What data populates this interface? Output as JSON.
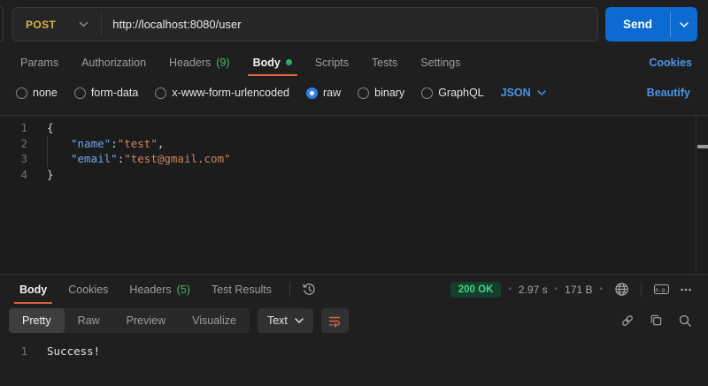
{
  "request_bar": {
    "method": "POST",
    "url": "http://localhost:8080/user",
    "send_label": "Send"
  },
  "request_tabs": {
    "items": [
      {
        "label": "Params"
      },
      {
        "label": "Authorization"
      },
      {
        "label": "Headers",
        "count": "(9)"
      },
      {
        "label": "Body",
        "active": true
      },
      {
        "label": "Scripts"
      },
      {
        "label": "Tests"
      },
      {
        "label": "Settings"
      }
    ],
    "cookies_link": "Cookies"
  },
  "body_type_bar": {
    "options": [
      {
        "label": "none"
      },
      {
        "label": "form-data"
      },
      {
        "label": "x-www-form-urlencoded"
      },
      {
        "label": "raw",
        "selected": true
      },
      {
        "label": "binary"
      },
      {
        "label": "GraphQL"
      }
    ],
    "format": "JSON",
    "beautify_label": "Beautify"
  },
  "request_editor": {
    "lines": [
      {
        "num": "1",
        "open_brace": "{"
      },
      {
        "num": "2",
        "key": "\"name\"",
        "colon": ":",
        "value": "\"test\"",
        "comma": ","
      },
      {
        "num": "3",
        "key": "\"email\"",
        "colon": ":",
        "value": "\"test@gmail.com\""
      },
      {
        "num": "4",
        "close_brace": "}"
      }
    ]
  },
  "response": {
    "tabs": [
      {
        "label": "Body",
        "active": true
      },
      {
        "label": "Cookies"
      },
      {
        "label": "Headers",
        "count": "(5)"
      },
      {
        "label": "Test Results"
      }
    ],
    "meta": {
      "status": "200 OK",
      "time": "2.97 s",
      "size": "171 B",
      "separator": "●"
    },
    "toolbar": {
      "views": [
        {
          "label": "Pretty",
          "active": true
        },
        {
          "label": "Raw"
        },
        {
          "label": "Preview"
        },
        {
          "label": "Visualize"
        }
      ],
      "format": "Text"
    },
    "body": {
      "line_num": "1",
      "text": "Success!"
    }
  },
  "icons": {
    "example_icon_text": "e.g."
  },
  "colors": {
    "method_post": "#dfb347",
    "send_button": "#0b6bd1",
    "link_blue": "#4a94e8",
    "count_green": "#3fba78",
    "status_green": "#3fd487",
    "status_pill_bg": "#143f2b",
    "active_tab_underline": "#d9603a",
    "code_key": "#6fa9e9",
    "code_value": "#cd8663",
    "radio_selected": "#2f80ed"
  }
}
